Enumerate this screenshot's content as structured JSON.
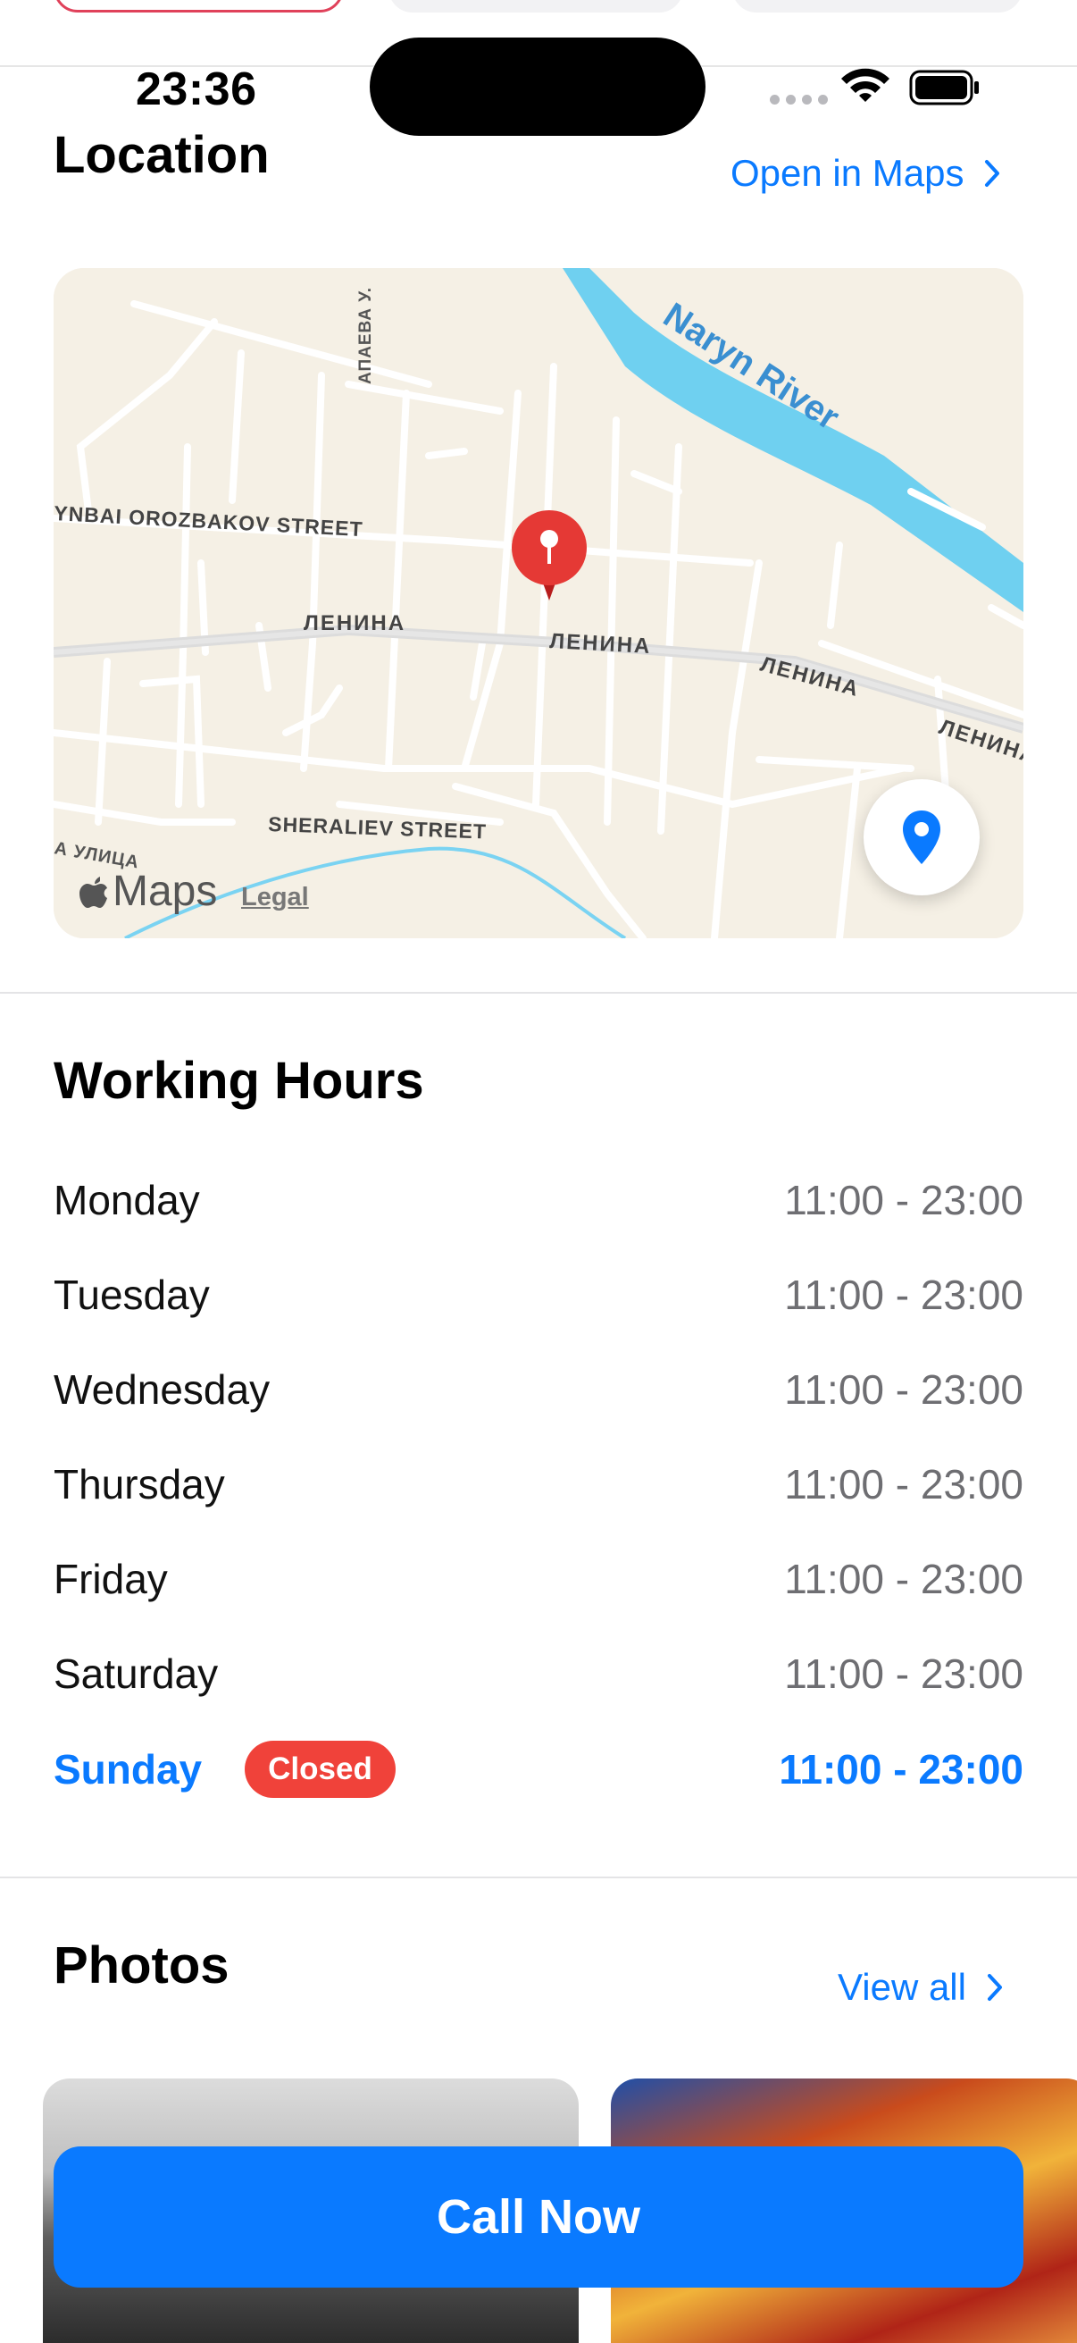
{
  "status_bar": {
    "time": "23:36"
  },
  "location": {
    "title": "Location",
    "open_link": "Open in Maps",
    "map": {
      "labels": {
        "river": "Naryn River",
        "street1": "YNBAI OROZBAKOV STREET",
        "street2": "ЛЕНИНА",
        "street3": "SHERALIEV STREET",
        "street4": "АПАЕВА У.",
        "street5": "А УЛИЦА"
      },
      "brand": "Maps",
      "legal": "Legal"
    }
  },
  "working_hours": {
    "title": "Working Hours",
    "days": [
      {
        "day": "Monday",
        "hours": "11:00 - 23:00"
      },
      {
        "day": "Tuesday",
        "hours": "11:00 - 23:00"
      },
      {
        "day": "Wednesday",
        "hours": "11:00 - 23:00"
      },
      {
        "day": "Thursday",
        "hours": "11:00 - 23:00"
      },
      {
        "day": "Friday",
        "hours": "11:00 - 23:00"
      },
      {
        "day": "Saturday",
        "hours": "11:00 - 23:00"
      },
      {
        "day": "Sunday",
        "hours": "11:00 - 23:00",
        "badge": "Closed",
        "today": true
      }
    ]
  },
  "photos": {
    "title": "Photos",
    "view_all": "View all"
  },
  "call_button": "Call Now",
  "colors": {
    "accent": "#0a7aff",
    "closed_badge": "#f0423a",
    "pin": "#e53935"
  },
  "icons": [
    "wifi-icon",
    "battery-icon",
    "chevron-right-icon",
    "location-pin-icon",
    "apple-logo-icon",
    "map-pin-marker-icon"
  ]
}
